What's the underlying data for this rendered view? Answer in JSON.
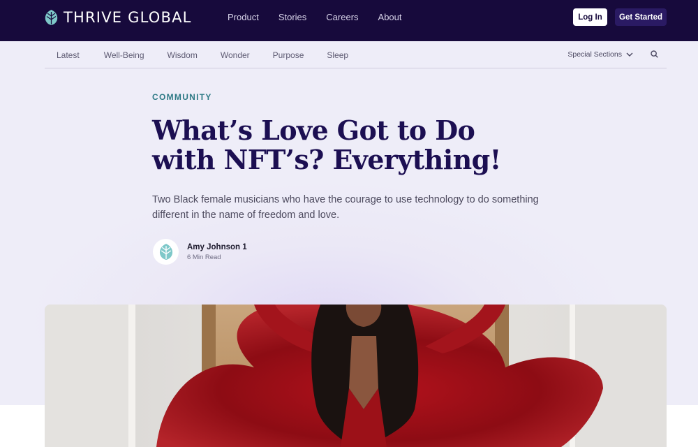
{
  "header": {
    "brand": "THRIVE GLOBAL",
    "nav": [
      "Product",
      "Stories",
      "Careers",
      "About"
    ],
    "login_label": "Log In",
    "get_started_label": "Get Started"
  },
  "subnav": {
    "items": [
      "Latest",
      "Well-Being",
      "Wisdom",
      "Wonder",
      "Purpose",
      "Sleep"
    ],
    "special_label": "Special Sections"
  },
  "article": {
    "category": "COMMUNITY",
    "title": "What’s Love Got to Do with NFT’s? Everything!",
    "dek": "Two Black female musicians who have the courage to use technology to do something different in the name of freedom and love.",
    "author": "Amy Johnson 1",
    "read_time": "6 Min Read"
  },
  "colors": {
    "header_bg": "#170a3c",
    "accent_teal": "#2e7a86",
    "headline": "#1c0f52",
    "logo_leaf": "#7ec8c9"
  },
  "icons": {
    "logo": "leaf-logo-icon",
    "special_sections": "chevron-down-icon",
    "search": "search-icon"
  }
}
